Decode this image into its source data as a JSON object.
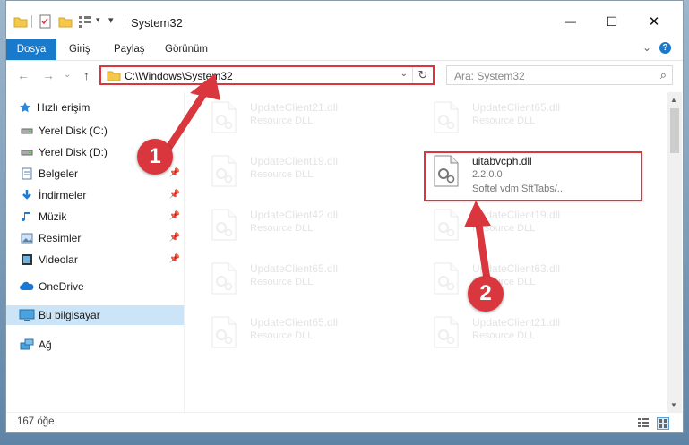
{
  "window": {
    "title": "System32",
    "minimize_glyph": "—",
    "maximize_glyph": "☐",
    "close_glyph": "✕"
  },
  "ribbon": {
    "tabs": [
      "Dosya",
      "Giriş",
      "Paylaş",
      "Görünüm"
    ],
    "collapse_glyph": "⌄",
    "help_glyph": "?"
  },
  "address": {
    "path": "C:\\Windows\\System32",
    "dropdown_glyph": "⌄",
    "refresh_glyph": "↻",
    "search_placeholder": "Ara: System32",
    "search_glyph": "⌕",
    "back_glyph": "←",
    "forward_glyph": "→",
    "recent_glyph": "⌄",
    "up_glyph": "↑"
  },
  "nav": {
    "quick_access": "Hızlı erişim",
    "items": [
      {
        "label": "Yerel Disk (C:)",
        "icon": "drive-icon",
        "pinned": false
      },
      {
        "label": "Yerel Disk (D:)",
        "icon": "drive-icon",
        "pinned": false
      },
      {
        "label": "Belgeler",
        "icon": "documents-icon",
        "pinned": true
      },
      {
        "label": "İndirmeler",
        "icon": "downloads-icon",
        "pinned": true
      },
      {
        "label": "Müzik",
        "icon": "music-icon",
        "pinned": true
      },
      {
        "label": "Resimler",
        "icon": "pictures-icon",
        "pinned": true
      },
      {
        "label": "Videolar",
        "icon": "videos-icon",
        "pinned": true
      }
    ],
    "pin_glyph": "📌",
    "onedrive": "OneDrive",
    "this_pc": "Bu bilgisayar",
    "network": "Ağ"
  },
  "files": {
    "left": [
      {
        "name": "UpdateClient21.dll",
        "type": "Resource DLL"
      },
      {
        "name": "UpdateClient19.dll",
        "type": "Resource DLL"
      },
      {
        "name": "UpdateClient42.dll",
        "type": "Resource DLL"
      },
      {
        "name": "UpdateClient65.dll",
        "type": "Resource DLL"
      },
      {
        "name": "UpdateClient65.dll",
        "type": "Resource DLL"
      }
    ],
    "right": [
      {
        "name": "UpdateClient65.dll",
        "type": "Resource DLL"
      },
      {
        "name": "uitabvcph.dll",
        "version": "2.2.0.0",
        "desc": "Softel vdm SftTabs/..."
      },
      {
        "name": "UpdateClient19.dll",
        "type": "Resource DLL"
      },
      {
        "name": "UpdateClient63.dll",
        "type": "Resource DLL"
      },
      {
        "name": "UpdateClient21.dll",
        "type": "Resource DLL"
      }
    ]
  },
  "status": {
    "count": "167 öğe"
  },
  "annotations": {
    "badge1": "1",
    "badge2": "2",
    "color": "#d9363e"
  }
}
